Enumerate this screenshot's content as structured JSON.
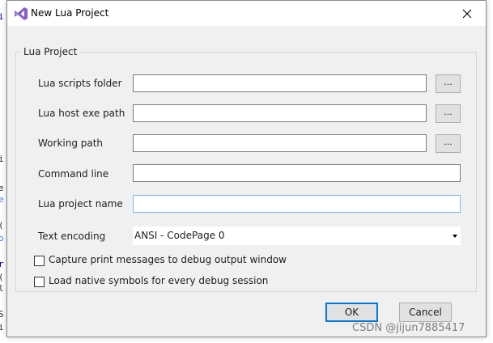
{
  "dialog": {
    "title": "New Lua Project",
    "close_symbol": "✕"
  },
  "group": {
    "label": "Lua Project"
  },
  "fields": {
    "scripts_folder": {
      "label": "Lua scripts folder",
      "value": "",
      "browse_label": "..."
    },
    "host_exe_path": {
      "label": "Lua host exe path",
      "value": "",
      "browse_label": "..."
    },
    "working_path": {
      "label": "Working path",
      "value": "",
      "browse_label": "..."
    },
    "command_line": {
      "label": "Command line",
      "value": ""
    },
    "project_name": {
      "label": "Lua project name",
      "value": ""
    },
    "text_encoding": {
      "label": "Text encoding",
      "selected": "ANSI - CodePage 0"
    }
  },
  "checkboxes": {
    "capture_print": {
      "label": "Capture print messages to debug output window",
      "checked": false
    },
    "load_symbols": {
      "label": "Load native symbols for every debug session",
      "checked": false
    }
  },
  "buttons": {
    "ok": "OK",
    "cancel": "Cancel"
  },
  "watermark": "CSDN @jijun7885417",
  "colors": {
    "accent": "#0078d7",
    "vs_purple": "#865fc5"
  }
}
